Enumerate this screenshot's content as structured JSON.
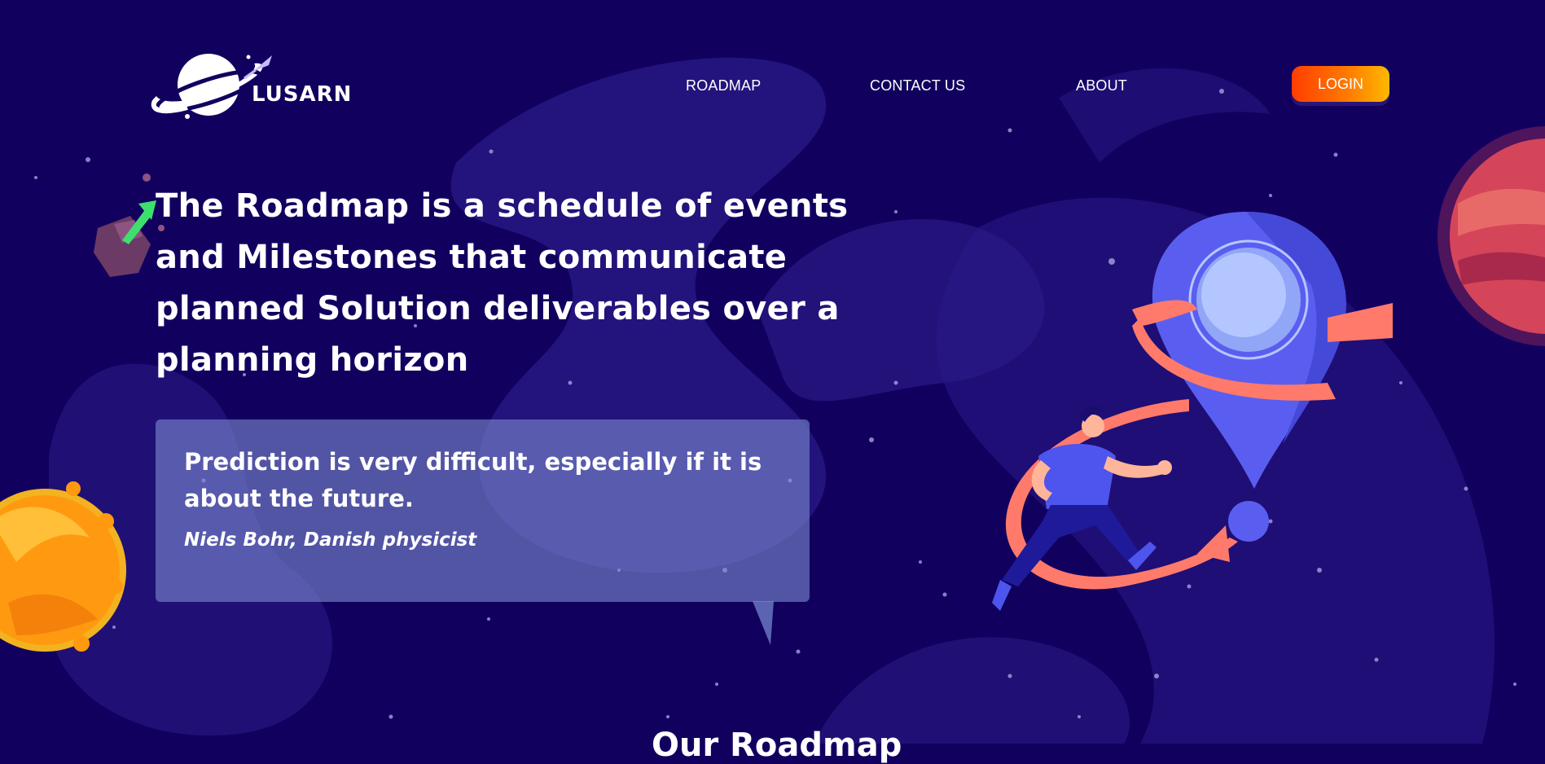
{
  "brand": {
    "name": "LUSARN"
  },
  "nav": {
    "roadmap": "ROADMAP",
    "contact": "CONTACT US",
    "about": "ABOUT",
    "login": "LOGIN"
  },
  "hero": {
    "headline": "The Roadmap is a schedule of events and Milestones that communicate planned Solution deliverables over a planning horizon",
    "quote": "Prediction is very difficult, especially if it is about the future.",
    "quote_author": "Niels Bohr, Danish physicist"
  },
  "next_section": {
    "title_peek": "Our Roadmap"
  },
  "colors": {
    "background": "#12005f",
    "accent_orange": "#ff5a00",
    "pin_blue": "#4d55ee",
    "ribbon_coral": "#ff7a6b",
    "quote_card": "#7a88ce"
  },
  "icons": [
    "planet-logo-icon",
    "rocket-icon",
    "location-pin-illustration",
    "runner-illustration",
    "sun-planet-icon",
    "red-planet-icon",
    "asteroid-icon"
  ]
}
